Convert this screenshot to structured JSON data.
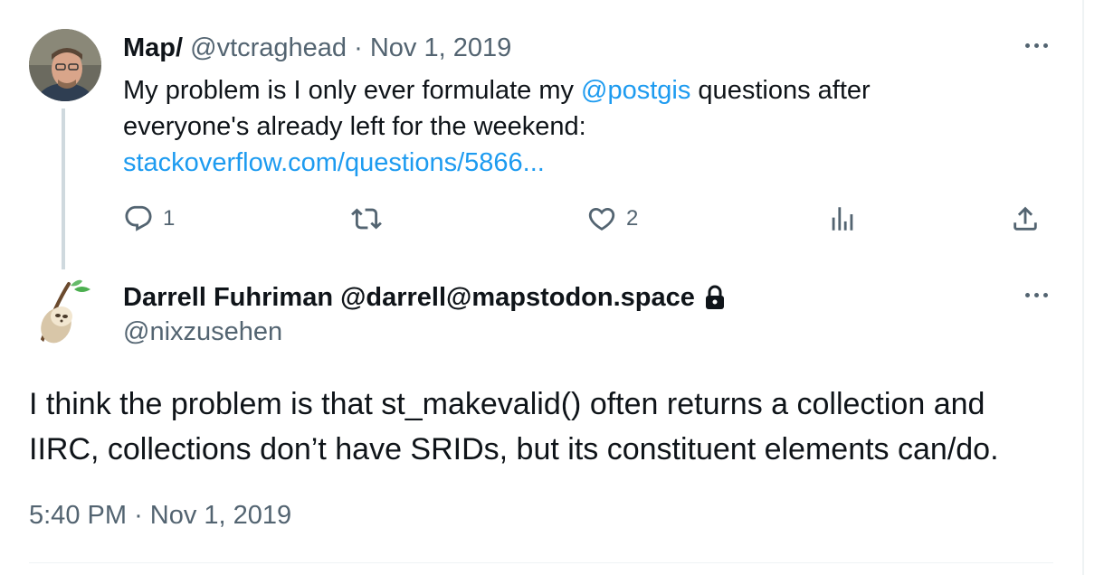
{
  "tweet1": {
    "name": "Map/",
    "handle": "@vtcraghead",
    "separator": "·",
    "date": "Nov 1, 2019",
    "text_before": "My problem is I only ever formulate my ",
    "mention": "@postgis",
    "text_after": " questions after everyone's already left for the weekend:",
    "link": "stackoverflow.com/questions/5866...",
    "actions": {
      "reply_icon": "reply-icon",
      "reply_count": "1",
      "retweet_icon": "retweet-icon",
      "retweet_count": "",
      "like_icon": "heart-icon",
      "like_count": "2",
      "views_icon": "views-icon",
      "share_icon": "share-icon"
    }
  },
  "tweet2": {
    "name": "Darrell Fuhriman @darrell@mapstodon.space",
    "lock_icon": "lock-icon",
    "handle": "@nixzusehen",
    "text": "I think the problem is that st_makevalid() often returns a collection and IIRC, collections don’t have SRIDs, but its constituent elements can/do.",
    "time": "5:40 PM",
    "separator": "·",
    "date": "Nov 1, 2019"
  },
  "colors": {
    "link": "#1d9bf0",
    "muted": "#536471",
    "text": "#0f1419",
    "thread_line": "#cfd9de"
  }
}
